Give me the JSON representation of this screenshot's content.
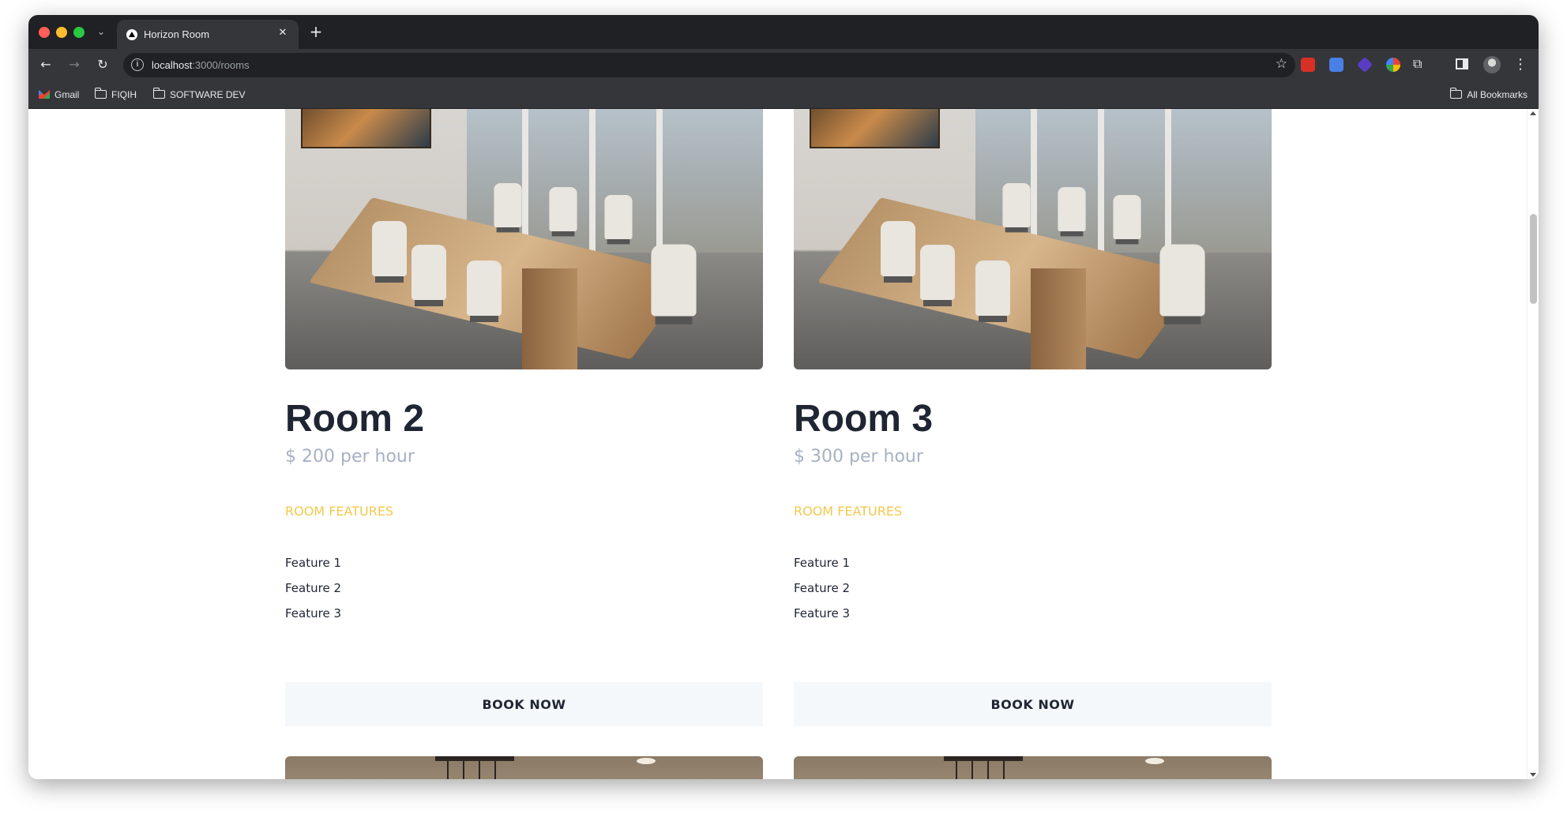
{
  "browser": {
    "tab_title": "Horizon Room",
    "tab_close_glyph": "✕",
    "new_tab_glyph": "+",
    "tab_search_glyph": "⌄",
    "url_host": "localhost",
    "url_rest": ":3000/rooms",
    "bookmarks": [
      {
        "label": "Gmail",
        "icon": "gmail-icon"
      },
      {
        "label": "FIQIH",
        "icon": "folder-icon"
      },
      {
        "label": "SOFTWARE DEV",
        "icon": "folder-icon"
      }
    ],
    "all_bookmarks_label": "All Bookmarks"
  },
  "rooms": [
    {
      "name": "Room 2",
      "price": "$ 200 per hour",
      "features_heading": "ROOM FEATURES",
      "features": [
        "Feature 1",
        "Feature 2",
        "Feature 3"
      ],
      "book_label": "BOOK NOW"
    },
    {
      "name": "Room 3",
      "price": "$ 300 per hour",
      "features_heading": "ROOM FEATURES",
      "features": [
        "Feature 1",
        "Feature 2",
        "Feature 3"
      ],
      "book_label": "BOOK NOW"
    }
  ],
  "colors": {
    "title": "#1f2533",
    "price": "#a7b1c2",
    "features_heading": "#f2c94c",
    "button_bg": "#f5f8fb"
  }
}
